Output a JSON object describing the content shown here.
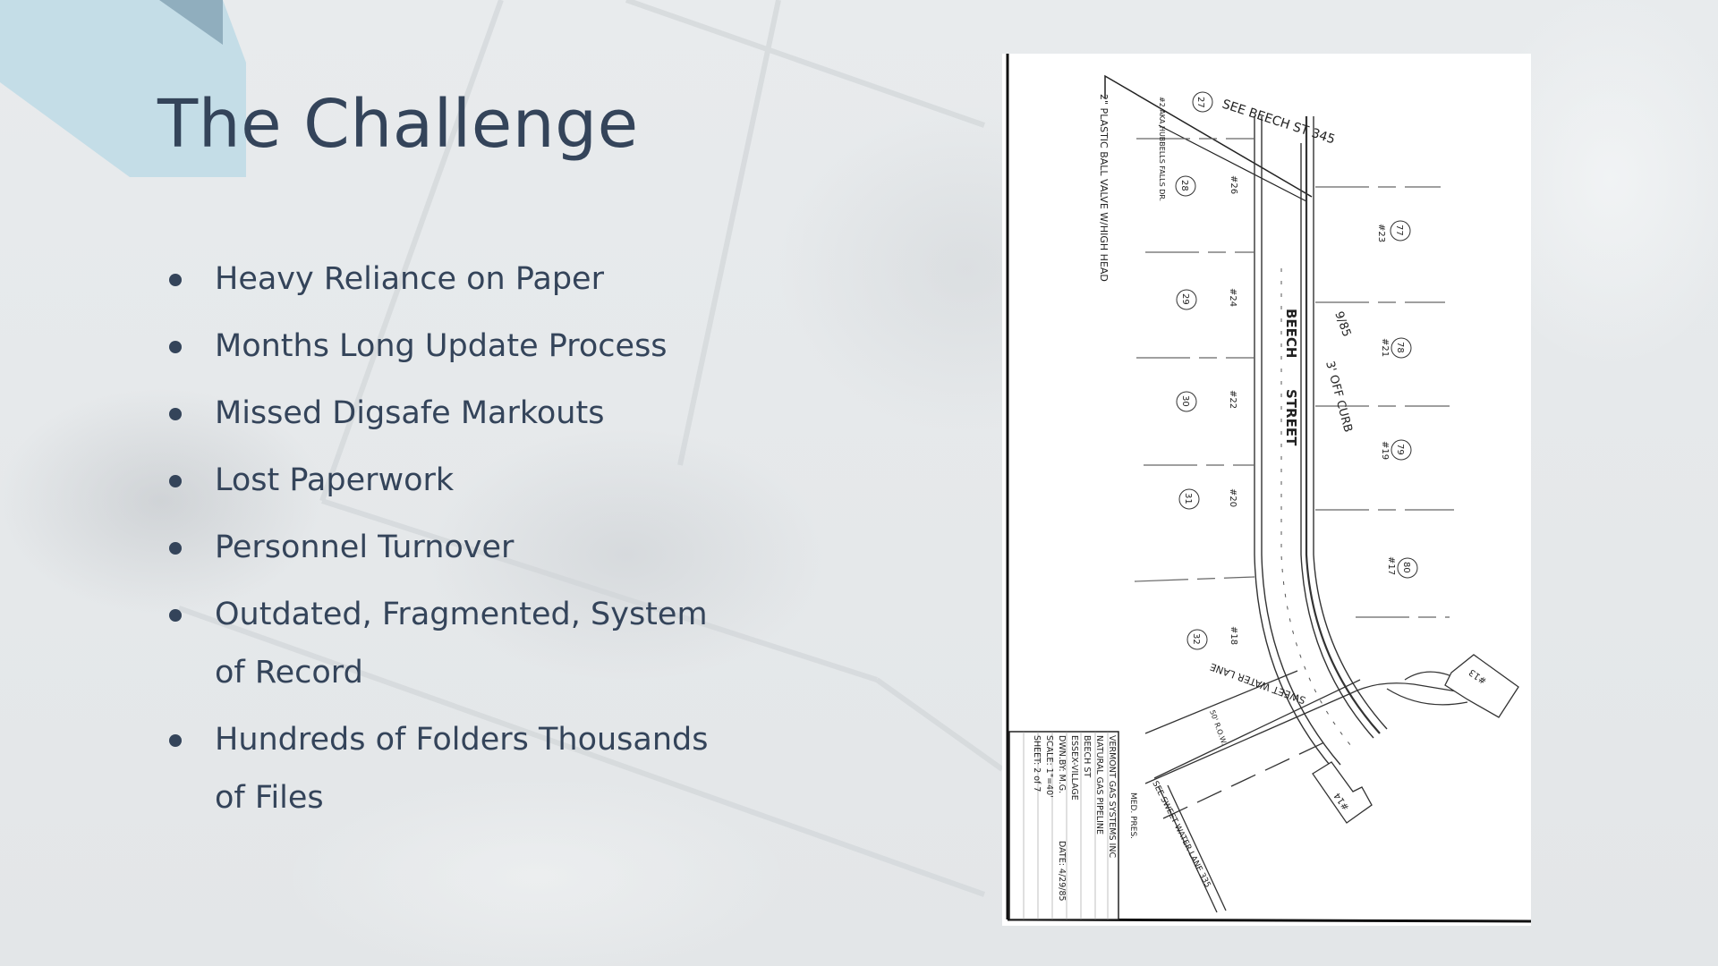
{
  "slide": {
    "title": "The Challenge",
    "bullets": [
      "Heavy Reliance on Paper",
      "Months Long Update Process",
      "Missed Digsafe Markouts",
      "Lost Paperwork",
      "Personnel Turnover",
      "Outdated, Fragmented, System of Record",
      "Hundreds of Folders Thousands of Files"
    ],
    "colors": {
      "text": "#34445a",
      "accent_light": "#c4dde7",
      "accent_dark": "#90aebe",
      "background": "#e6e9eb"
    }
  },
  "map": {
    "street_label_1": "BEECH",
    "street_label_2": "STREET",
    "see_note": "SEE BEECH ST 345",
    "valve_note": "2\" PLASTIC BALL VALVE W/HIGH HEAD",
    "curb_note": "3' OFF CURB",
    "date_note": "9/85",
    "cross_street": "SWEET WATER LANE",
    "row_note": "50' R.O.W.",
    "sweetwater_ref": "SEE SWEET WATER LANE 335",
    "hubbell_note": "#2 AKA HUBBELLS FALLS DR.",
    "lots_left": [
      {
        "circle": "27",
        "house": ""
      },
      {
        "circle": "28",
        "house": "#26"
      },
      {
        "circle": "29",
        "house": "#24"
      },
      {
        "circle": "30",
        "house": "#22"
      },
      {
        "circle": "31",
        "house": "#20"
      },
      {
        "circle": "32",
        "house": "#18"
      }
    ],
    "lots_right": [
      {
        "circle": "77",
        "house": "#23"
      },
      {
        "circle": "78",
        "house": "#21"
      },
      {
        "circle": "79",
        "house": "#19"
      },
      {
        "circle": "80",
        "house": "#17"
      }
    ],
    "buildings": [
      "#13",
      "#14"
    ],
    "title_block": {
      "pressure": "MED. PRES.",
      "company": "VERMONT GAS SYSTEMS INC",
      "project": "NATURAL GAS PIPELINE",
      "street": "BEECH ST",
      "town": "ESSEX-VILLAGE",
      "drawn_by": "DWN.BY: M.G.",
      "date": "DATE: 4/29/85",
      "scale": "SCALE: 1\"=40'",
      "sheet": "SHEET: 2 of 7"
    }
  }
}
